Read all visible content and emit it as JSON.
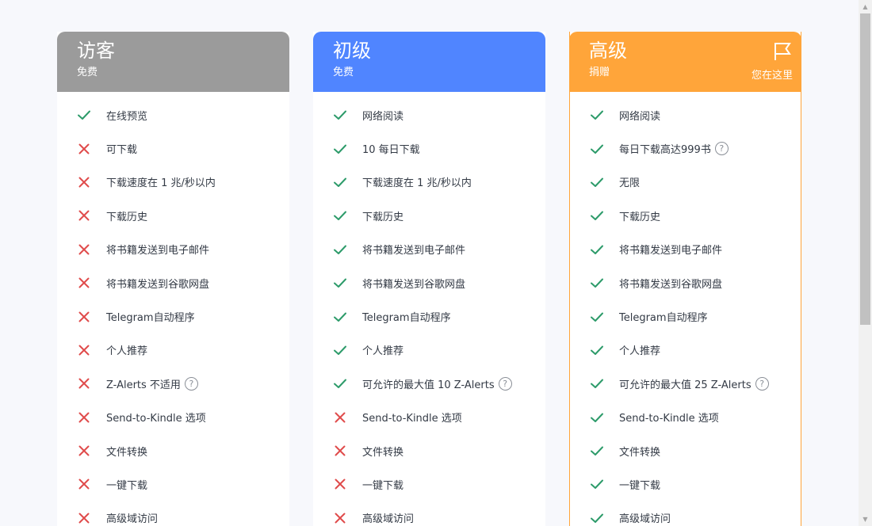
{
  "plans": [
    {
      "name": "访客",
      "price": "免费",
      "color": "#9b9b9b",
      "features": [
        {
          "ok": true,
          "text": "在线预览"
        },
        {
          "ok": false,
          "text": "可下载"
        },
        {
          "ok": false,
          "text": "下载速度在 1 兆/秒以内"
        },
        {
          "ok": false,
          "text": "下载历史"
        },
        {
          "ok": false,
          "text": "将书籍发送到电子邮件"
        },
        {
          "ok": false,
          "text": "将书籍发送到谷歌网盘"
        },
        {
          "ok": false,
          "text": "Telegram自动程序"
        },
        {
          "ok": false,
          "text": "个人推荐"
        },
        {
          "ok": false,
          "text": "Z-Alerts 不适用",
          "help": true
        },
        {
          "ok": false,
          "text": "Send-to-Kindle 选项"
        },
        {
          "ok": false,
          "text": "文件转换"
        },
        {
          "ok": false,
          "text": "一键下载"
        },
        {
          "ok": false,
          "text": "高级域访问"
        }
      ]
    },
    {
      "name": "初级",
      "price": "免费",
      "color": "#5085ff",
      "features": [
        {
          "ok": true,
          "text": "网络阅读"
        },
        {
          "ok": true,
          "text": "10 每日下载"
        },
        {
          "ok": true,
          "text": "下载速度在 1 兆/秒以内"
        },
        {
          "ok": true,
          "text": "下载历史"
        },
        {
          "ok": true,
          "text": "将书籍发送到电子邮件"
        },
        {
          "ok": true,
          "text": "将书籍发送到谷歌网盘"
        },
        {
          "ok": true,
          "text": "Telegram自动程序"
        },
        {
          "ok": true,
          "text": "个人推荐"
        },
        {
          "ok": true,
          "text": "可允许的最大值 10 Z-Alerts",
          "help": true
        },
        {
          "ok": false,
          "text": "Send-to-Kindle 选项"
        },
        {
          "ok": false,
          "text": "文件转换"
        },
        {
          "ok": false,
          "text": "一键下载"
        },
        {
          "ok": false,
          "text": "高级域访问"
        }
      ]
    },
    {
      "name": "高级",
      "price": "捐赠",
      "color": "#ffa53a",
      "current": true,
      "current_label": "您在这里",
      "features": [
        {
          "ok": true,
          "text": "网络阅读"
        },
        {
          "ok": true,
          "text": "每日下载高达999书",
          "help": true
        },
        {
          "ok": true,
          "text": "无限"
        },
        {
          "ok": true,
          "text": "下载历史"
        },
        {
          "ok": true,
          "text": "将书籍发送到电子邮件"
        },
        {
          "ok": true,
          "text": "将书籍发送到谷歌网盘"
        },
        {
          "ok": true,
          "text": "Telegram自动程序"
        },
        {
          "ok": true,
          "text": "个人推荐"
        },
        {
          "ok": true,
          "text": "可允许的最大值 25 Z-Alerts",
          "help": true
        },
        {
          "ok": true,
          "text": "Send-to-Kindle 选项"
        },
        {
          "ok": true,
          "text": "文件转换"
        },
        {
          "ok": true,
          "text": "一键下载"
        },
        {
          "ok": true,
          "text": "高级域访问"
        }
      ]
    }
  ],
  "help_glyph": "?",
  "icons": {
    "check": "check-icon",
    "cross": "cross-icon",
    "flag": "flag-icon",
    "help": "help-icon"
  },
  "colors": {
    "check": "#2d9b6a",
    "cross": "#e04b4b",
    "text": "#333a45"
  },
  "scrollbar": {
    "up_glyph": "▲",
    "down_glyph": "▼"
  }
}
